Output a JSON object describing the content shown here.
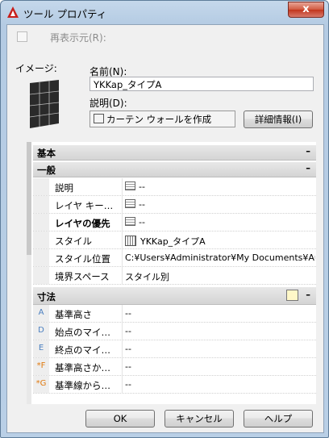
{
  "window": {
    "title": "ツール プロパティ",
    "close_glyph": "x"
  },
  "redisplay": {
    "label": "再表示元(R):"
  },
  "image_label": "イメージ:",
  "name": {
    "label": "名前(N):",
    "value": "YKKap_タイプA"
  },
  "description": {
    "label": "説明(D):",
    "value": "カーテン ウォールを作成"
  },
  "details_button": "詳細情報(I)",
  "grid": {
    "basic": {
      "label": "基本",
      "toggle": "–"
    },
    "general": {
      "label": "一般",
      "toggle": "–",
      "rows": [
        {
          "name": "説明",
          "value": "--"
        },
        {
          "name": "レイヤ キー…",
          "value": "--"
        },
        {
          "name": "レイヤの優先",
          "value": "--"
        },
        {
          "name": "スタイル",
          "value": "YKKap_タイプA"
        },
        {
          "name": "スタイル位置",
          "value": "C:¥Users¥Administrator¥My  Documents¥Au…"
        },
        {
          "name": "境界スペース",
          "value": "スタイル別"
        }
      ]
    },
    "dimensions": {
      "label": "寸法",
      "toggle": "–",
      "rows": [
        {
          "marker": "A",
          "name": "基準高さ",
          "value": "--"
        },
        {
          "marker": "D",
          "name": "始点のマイ…",
          "value": "--"
        },
        {
          "marker": "E",
          "name": "終点のマイ…",
          "value": "--"
        },
        {
          "marker": "F",
          "name": "基準高さか…",
          "value": "--"
        },
        {
          "marker": "G",
          "name": "基準線から…",
          "value": "--"
        }
      ]
    }
  },
  "buttons": {
    "ok": "OK",
    "cancel": "キャンセル",
    "help": "ヘルプ"
  },
  "colors": {
    "accent": "#c2351c",
    "title_bg": "#b9cfe6"
  }
}
